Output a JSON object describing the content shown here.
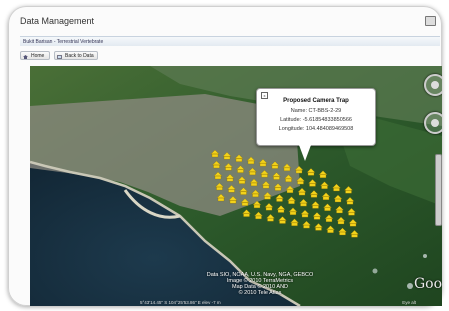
{
  "window": {
    "title": "Data Management"
  },
  "breadcrumb": {
    "text": "Bukit Barisan - Terrestrial Vertebrate"
  },
  "toolbar": {
    "home_label": "Home",
    "back_label": "Back to Data"
  },
  "popup": {
    "close_label": "x",
    "title": "Proposed Camera Trap",
    "name_line": "Name: CT-BBS-2-29",
    "latitude_line": "Latitude: -5.61854833850566",
    "longitude_line": "Longitude: 104.484089469508"
  },
  "map": {
    "credits": [
      "Data SIO, NOAA, U.S. Navy, NGA, GEBCO",
      "Image © 2010 TerraMetrics",
      "Map Data © 2010 AND",
      "© 2010 Tele Atlas"
    ],
    "coords_text": "5°43'14.45\" S  104°25'53.86\" E  elev  -7 m",
    "powered_text": "Eye alt",
    "logo_text": "Goo",
    "colors": {
      "ocean": "#0e2230",
      "land": "#2b5a2a",
      "overlay": "#8a8a82",
      "marker": "#f2d21a"
    }
  }
}
